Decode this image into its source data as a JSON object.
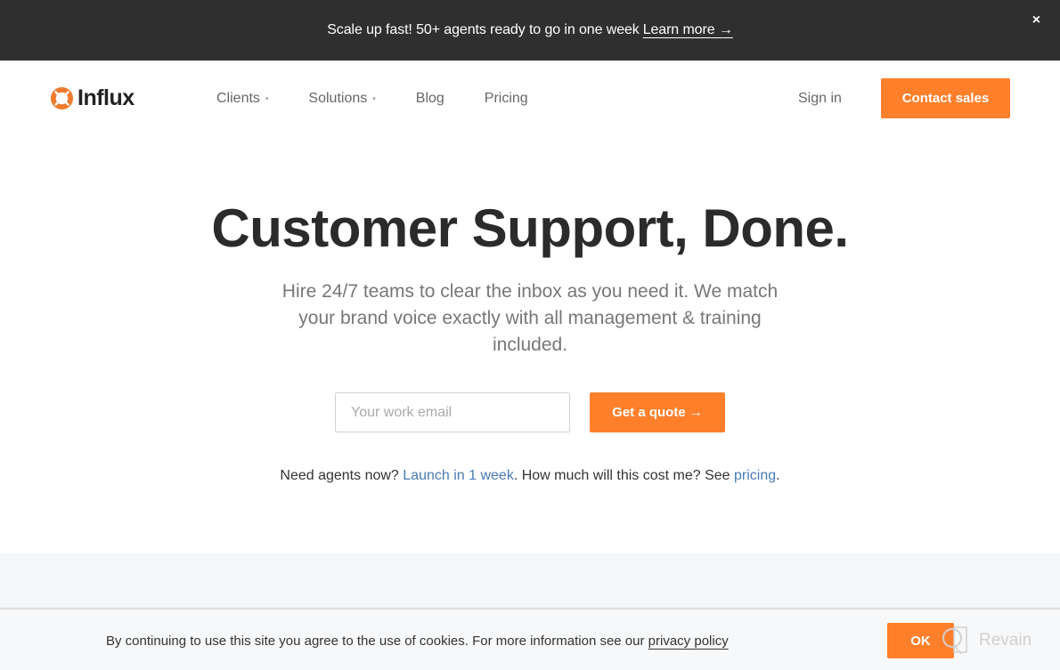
{
  "promo": {
    "text": "Scale up fast! 50+ agents ready to go in one week",
    "link_label": "Learn more →",
    "close_label": "×"
  },
  "brand": {
    "name": "Influx",
    "accent_color": "#ff7f2a"
  },
  "nav": {
    "items": [
      {
        "label": "Clients",
        "has_dropdown": true
      },
      {
        "label": "Solutions",
        "has_dropdown": true
      },
      {
        "label": "Blog",
        "has_dropdown": false
      },
      {
        "label": "Pricing",
        "has_dropdown": false
      }
    ],
    "dropdown_marker": "•",
    "signin_label": "Sign in",
    "contact_label": "Contact sales"
  },
  "hero": {
    "title": "Customer Support, Done.",
    "subtitle": "Hire 24/7 teams to clear the inbox as you need it. We match your brand voice exactly with all management & training included.",
    "email_placeholder": "Your work email",
    "email_value": "",
    "quote_label": "Get a quote →",
    "note_prefix": "Need agents now?",
    "note_link1": "Launch in 1 week",
    "note_middle": ". How much will this cost me? See",
    "note_link2": "pricing",
    "note_suffix": "."
  },
  "cookie": {
    "text": "By continuing to use this site you agree to the use of cookies. For more information see our",
    "link_label": "privacy policy",
    "ok_label": "OK"
  },
  "watermark": {
    "text": "Revain"
  }
}
